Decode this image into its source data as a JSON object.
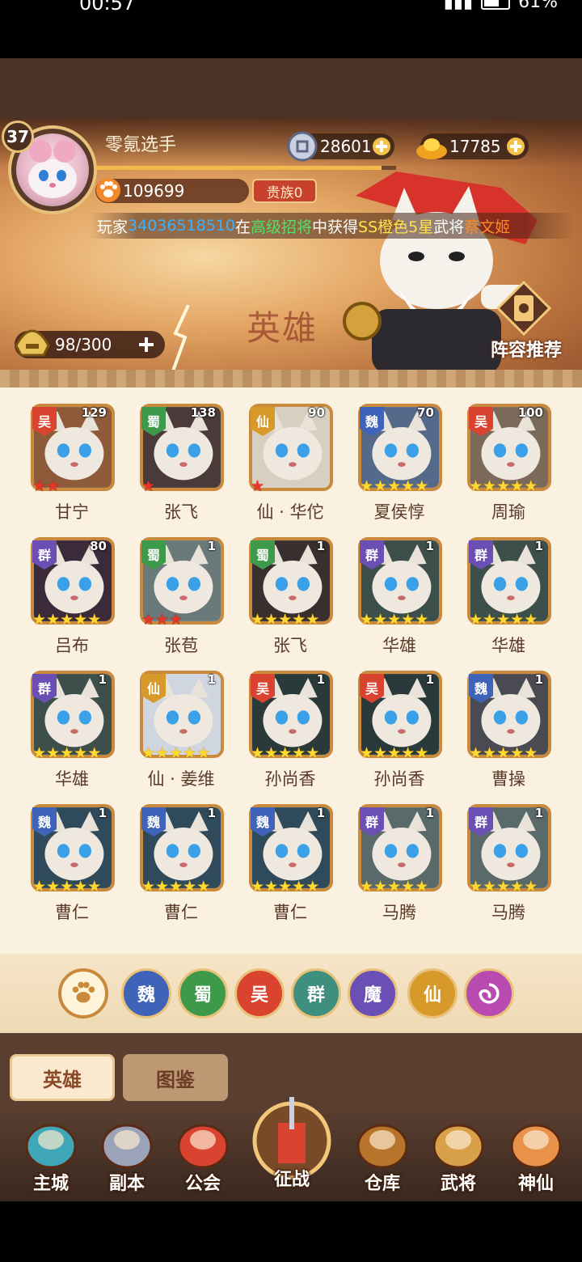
{
  "status_bar": {
    "time": "00:57",
    "battery": "61%"
  },
  "player": {
    "level": "37",
    "name": "零氪选手",
    "power": "109699",
    "noble": "贵族0",
    "xp_fraction": 0.95
  },
  "currency": {
    "silver": "28601",
    "gold": "17785"
  },
  "marquee": {
    "p1": "玩家",
    "player_id": "34036518510",
    "p2": "在",
    "source": "高级招将",
    "p3": "中获得",
    "grade": "SS橙色5星",
    "p4": "武将",
    "hero": "蔡文姬"
  },
  "capacity": "98/300",
  "banner_text": "英雄",
  "recommend": "阵容推荐",
  "heroes": [
    {
      "name": "甘宁",
      "faction": "吴",
      "level": "129",
      "stars": 2,
      "star_color": "red"
    },
    {
      "name": "张飞",
      "faction": "蜀",
      "level": "138",
      "stars": 1,
      "star_color": "red"
    },
    {
      "name": "仙 · 华佗",
      "faction": "仙",
      "level": "90",
      "stars": 1,
      "star_color": "red"
    },
    {
      "name": "夏侯惇",
      "faction": "魏",
      "level": "70",
      "stars": 5,
      "star_color": "gold"
    },
    {
      "name": "周瑜",
      "faction": "吴",
      "level": "100",
      "stars": 5,
      "star_color": "gold"
    },
    {
      "name": "吕布",
      "faction": "群",
      "level": "80",
      "stars": 5,
      "star_color": "gold"
    },
    {
      "name": "张苞",
      "faction": "蜀",
      "level": "1",
      "stars": 3,
      "star_color": "red"
    },
    {
      "name": "张飞",
      "faction": "蜀",
      "level": "1",
      "stars": 5,
      "star_color": "gold"
    },
    {
      "name": "华雄",
      "faction": "群",
      "level": "1",
      "stars": 5,
      "star_color": "gold"
    },
    {
      "name": "华雄",
      "faction": "群",
      "level": "1",
      "stars": 5,
      "star_color": "gold"
    },
    {
      "name": "华雄",
      "faction": "群",
      "level": "1",
      "stars": 5,
      "star_color": "gold"
    },
    {
      "name": "仙 · 姜维",
      "faction": "仙",
      "level": "1",
      "stars": 5,
      "star_color": "gold"
    },
    {
      "name": "孙尚香",
      "faction": "吴",
      "level": "1",
      "stars": 5,
      "star_color": "gold"
    },
    {
      "name": "孙尚香",
      "faction": "吴",
      "level": "1",
      "stars": 5,
      "star_color": "gold"
    },
    {
      "name": "曹操",
      "faction": "魏",
      "level": "1",
      "stars": 5,
      "star_color": "gold"
    },
    {
      "name": "曹仁",
      "faction": "魏",
      "level": "1",
      "stars": 5,
      "star_color": "gold"
    },
    {
      "name": "曹仁",
      "faction": "魏",
      "level": "1",
      "stars": 5,
      "star_color": "gold"
    },
    {
      "name": "曹仁",
      "faction": "魏",
      "level": "1",
      "stars": 5,
      "star_color": "gold"
    },
    {
      "name": "马腾",
      "faction": "群",
      "level": "1",
      "stars": 5,
      "star_color": "gold"
    },
    {
      "name": "马腾",
      "faction": "群",
      "level": "1",
      "stars": 5,
      "star_color": "gold"
    }
  ],
  "faction_colors": {
    "吴": "#d9432f",
    "蜀": "#3c9a4a",
    "仙": "#d79a2a",
    "魏": "#3f63b8",
    "群": "#6b4fb5"
  },
  "filters": [
    {
      "id": "all",
      "label": "",
      "color": "#fff3d9"
    },
    {
      "id": "wei",
      "label": "魏",
      "color": "#3f63b8"
    },
    {
      "id": "shu",
      "label": "蜀",
      "color": "#3c9a4a"
    },
    {
      "id": "wu",
      "label": "吴",
      "color": "#d9432f"
    },
    {
      "id": "qun",
      "label": "群",
      "color": "#3f8f7f"
    },
    {
      "id": "mo",
      "label": "魔",
      "color": "#6b4fb5"
    },
    {
      "id": "xian",
      "label": "仙",
      "color": "#d79a2a"
    },
    {
      "id": "special",
      "label": "",
      "color": "#b84ab0"
    }
  ],
  "tabs": {
    "heroes": "英雄",
    "codex": "图鉴"
  },
  "nav": [
    {
      "label": "主城",
      "icon": "castle-icon"
    },
    {
      "label": "副本",
      "icon": "sword-icon"
    },
    {
      "label": "公会",
      "icon": "guild-flag-icon"
    },
    {
      "label": "征战",
      "icon": "battle-gate-icon"
    },
    {
      "label": "仓库",
      "icon": "treasure-bag-icon"
    },
    {
      "label": "武将",
      "icon": "general-cat-icon"
    },
    {
      "label": "神仙",
      "icon": "immortal-cat-icon"
    }
  ]
}
